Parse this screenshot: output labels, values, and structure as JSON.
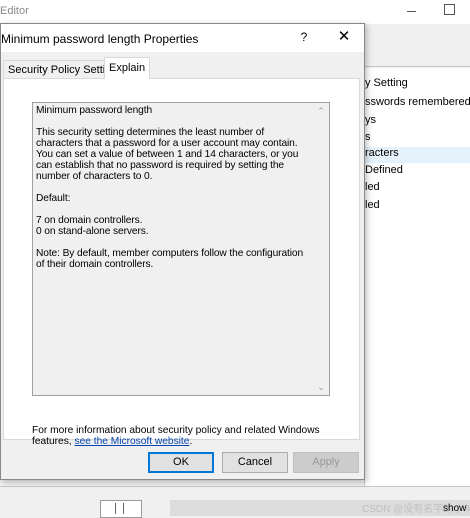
{
  "background_window": {
    "title": "Editor",
    "list_items": [
      "y Setting",
      "sswords remembered",
      "ys",
      "s",
      "racters",
      "Defined",
      "led",
      "led"
    ],
    "selected_index": 4,
    "show_label": "show",
    "watermark": "CSDN @没有名字的小羊"
  },
  "dialog": {
    "title": "Minimum password length Properties",
    "help_glyph": "?",
    "close_glyph": "✕",
    "tabs": [
      {
        "label": "Security Policy Setting",
        "active": false
      },
      {
        "label": "Explain",
        "active": true
      }
    ],
    "explain": {
      "heading": "Minimum password length",
      "paragraph1": "This security setting determines the least number of characters that a password for a user account may contain. You can set a value of between 1 and 14 characters, or you can establish that no password is required by setting the number of characters to 0.",
      "default_label": "Default:",
      "default_lines": "7 on domain controllers.\n0 on stand-alone servers.",
      "note": "Note: By default, member computers follow the configuration of their domain controllers."
    },
    "more_info_text": "For more information about security policy and related Windows features, ",
    "more_info_link": "see the Microsoft website",
    "more_info_end": ".",
    "buttons": {
      "ok": "OK",
      "cancel": "Cancel",
      "apply": "Apply"
    }
  }
}
